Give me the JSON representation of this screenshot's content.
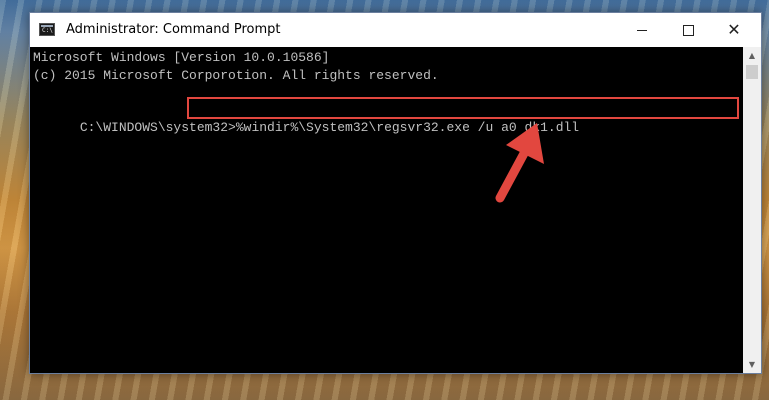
{
  "window": {
    "title": "Administrator: Command Prompt",
    "icon_text": "C:\\",
    "minimize_symbol": "",
    "maximize_symbol": "",
    "close_symbol": "✕"
  },
  "console": {
    "lines": [
      "Microsoft Windows [Version 10.0.10586]",
      "(c) 2015 Microsoft Corporotion. All rights reserved."
    ],
    "prompt": "C:\\WINDOWS\\system32>",
    "command": "%windir%\\System32\\regsvr32.exe /u a0 dk1.dll"
  },
  "scrollbar": {
    "up_symbol": "▲",
    "down_symbol": "▼"
  },
  "colors": {
    "console_background": "#000000",
    "console_text": "#c0c0c0",
    "highlight": "#e2473f",
    "titlebar": "#ffffff"
  }
}
